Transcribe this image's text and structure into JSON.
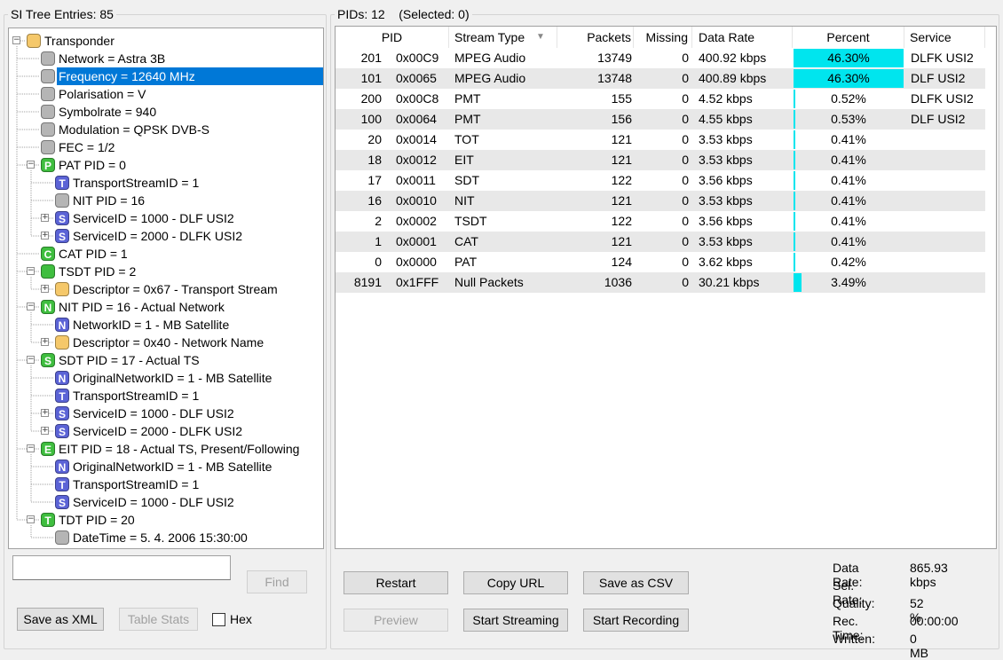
{
  "tree": {
    "title": "SI Tree Entries: 85",
    "nodes": [
      {
        "label": "Transponder",
        "indent": 0,
        "expander": "-",
        "icon": "folder",
        "letter": ""
      },
      {
        "label": "Network = Astra 3B",
        "indent": 1,
        "expander": "",
        "icon": "gray",
        "letter": ""
      },
      {
        "label": "Frequency = 12640 MHz",
        "indent": 1,
        "expander": "",
        "icon": "gray",
        "letter": "",
        "selected": true
      },
      {
        "label": "Polarisation = V",
        "indent": 1,
        "expander": "",
        "icon": "gray",
        "letter": ""
      },
      {
        "label": "Symbolrate = 940",
        "indent": 1,
        "expander": "",
        "icon": "gray",
        "letter": ""
      },
      {
        "label": "Modulation = QPSK DVB-S",
        "indent": 1,
        "expander": "",
        "icon": "gray",
        "letter": ""
      },
      {
        "label": "FEC = 1/2",
        "indent": 1,
        "expander": "",
        "icon": "gray",
        "letter": ""
      },
      {
        "label": "PAT PID = 0",
        "indent": 1,
        "expander": "-",
        "icon": "green",
        "letter": "P"
      },
      {
        "label": "TransportStreamID = 1",
        "indent": 2,
        "expander": "",
        "icon": "blue",
        "letter": "T"
      },
      {
        "label": "NIT PID = 16",
        "indent": 2,
        "expander": "",
        "icon": "gray",
        "letter": ""
      },
      {
        "label": "ServiceID = 1000 - DLF USI2",
        "indent": 2,
        "expander": "+",
        "icon": "blue",
        "letter": "S"
      },
      {
        "label": "ServiceID = 2000 - DLFK USI2",
        "indent": 2,
        "expander": "+",
        "icon": "blue",
        "letter": "S"
      },
      {
        "label": "CAT PID = 1",
        "indent": 1,
        "expander": "",
        "icon": "green",
        "letter": "C"
      },
      {
        "label": "TSDT PID = 2",
        "indent": 1,
        "expander": "-",
        "icon": "green",
        "letter": ""
      },
      {
        "label": "Descriptor = 0x67 - Transport Stream",
        "indent": 2,
        "expander": "+",
        "icon": "folder",
        "letter": ""
      },
      {
        "label": "NIT PID = 16 - Actual Network",
        "indent": 1,
        "expander": "-",
        "icon": "green",
        "letter": "N"
      },
      {
        "label": "NetworkID = 1 - MB Satellite",
        "indent": 2,
        "expander": "",
        "icon": "blue",
        "letter": "N"
      },
      {
        "label": "Descriptor = 0x40 - Network Name",
        "indent": 2,
        "expander": "+",
        "icon": "folder",
        "letter": ""
      },
      {
        "label": "SDT PID = 17 - Actual TS",
        "indent": 1,
        "expander": "-",
        "icon": "green",
        "letter": "S"
      },
      {
        "label": "OriginalNetworkID = 1 - MB Satellite",
        "indent": 2,
        "expander": "",
        "icon": "blue",
        "letter": "N"
      },
      {
        "label": "TransportStreamID = 1",
        "indent": 2,
        "expander": "",
        "icon": "blue",
        "letter": "T"
      },
      {
        "label": "ServiceID = 1000 - DLF USI2",
        "indent": 2,
        "expander": "+",
        "icon": "blue",
        "letter": "S"
      },
      {
        "label": "ServiceID = 2000 - DLFK USI2",
        "indent": 2,
        "expander": "+",
        "icon": "blue",
        "letter": "S"
      },
      {
        "label": "EIT PID = 18 - Actual TS, Present/Following",
        "indent": 1,
        "expander": "-",
        "icon": "green",
        "letter": "E"
      },
      {
        "label": "OriginalNetworkID = 1 - MB Satellite",
        "indent": 2,
        "expander": "",
        "icon": "blue",
        "letter": "N"
      },
      {
        "label": "TransportStreamID = 1",
        "indent": 2,
        "expander": "",
        "icon": "blue",
        "letter": "T"
      },
      {
        "label": "ServiceID = 1000 - DLF USI2",
        "indent": 2,
        "expander": "",
        "icon": "blue",
        "letter": "S"
      },
      {
        "label": "TDT PID = 20",
        "indent": 1,
        "expander": "-",
        "icon": "green",
        "letter": "T"
      },
      {
        "label": "DateTime = 5. 4. 2006 15:30:00",
        "indent": 2,
        "expander": "",
        "icon": "gray",
        "letter": ""
      }
    ]
  },
  "left_controls": {
    "find_value": "",
    "find_label": "Find",
    "save_xml_label": "Save as XML",
    "table_stats_label": "Table Stats",
    "hex_label": "Hex"
  },
  "pids": {
    "title": "PIDs: 12    (Selected: 0)",
    "columns": {
      "pid": "PID",
      "stream_type": "Stream Type",
      "packets": "Packets",
      "missing": "Missing",
      "data_rate": "Data Rate",
      "percent": "Percent",
      "service": "Service"
    },
    "rows": [
      {
        "pid": "201",
        "hex": "0x00C9",
        "type": "MPEG Audio",
        "packets": "13749",
        "missing": "0",
        "rate": "400.92 kbps",
        "percent": "46.30%",
        "pct": 46.3,
        "service": "DLFK USI2"
      },
      {
        "pid": "101",
        "hex": "0x0065",
        "type": "MPEG Audio",
        "packets": "13748",
        "missing": "0",
        "rate": "400.89 kbps",
        "percent": "46.30%",
        "pct": 46.3,
        "service": "DLF USI2"
      },
      {
        "pid": "200",
        "hex": "0x00C8",
        "type": "PMT",
        "packets": "155",
        "missing": "0",
        "rate": "4.52 kbps",
        "percent": "0.52%",
        "pct": 0.52,
        "service": "DLFK USI2"
      },
      {
        "pid": "100",
        "hex": "0x0064",
        "type": "PMT",
        "packets": "156",
        "missing": "0",
        "rate": "4.55 kbps",
        "percent": "0.53%",
        "pct": 0.53,
        "service": "DLF USI2"
      },
      {
        "pid": "20",
        "hex": "0x0014",
        "type": "TOT",
        "packets": "121",
        "missing": "0",
        "rate": "3.53 kbps",
        "percent": "0.41%",
        "pct": 0.41,
        "service": ""
      },
      {
        "pid": "18",
        "hex": "0x0012",
        "type": "EIT",
        "packets": "121",
        "missing": "0",
        "rate": "3.53 kbps",
        "percent": "0.41%",
        "pct": 0.41,
        "service": ""
      },
      {
        "pid": "17",
        "hex": "0x0011",
        "type": "SDT",
        "packets": "122",
        "missing": "0",
        "rate": "3.56 kbps",
        "percent": "0.41%",
        "pct": 0.41,
        "service": ""
      },
      {
        "pid": "16",
        "hex": "0x0010",
        "type": "NIT",
        "packets": "121",
        "missing": "0",
        "rate": "3.53 kbps",
        "percent": "0.41%",
        "pct": 0.41,
        "service": ""
      },
      {
        "pid": "2",
        "hex": "0x0002",
        "type": "TSDT",
        "packets": "122",
        "missing": "0",
        "rate": "3.56 kbps",
        "percent": "0.41%",
        "pct": 0.41,
        "service": ""
      },
      {
        "pid": "1",
        "hex": "0x0001",
        "type": "CAT",
        "packets": "121",
        "missing": "0",
        "rate": "3.53 kbps",
        "percent": "0.41%",
        "pct": 0.41,
        "service": ""
      },
      {
        "pid": "0",
        "hex": "0x0000",
        "type": "PAT",
        "packets": "124",
        "missing": "0",
        "rate": "3.62 kbps",
        "percent": "0.42%",
        "pct": 0.42,
        "service": ""
      },
      {
        "pid": "8191",
        "hex": "0x1FFF",
        "type": "Null Packets",
        "packets": "1036",
        "missing": "0",
        "rate": "30.21 kbps",
        "percent": "3.49%",
        "pct": 3.49,
        "service": ""
      }
    ]
  },
  "buttons": {
    "restart": "Restart",
    "copy_url": "Copy URL",
    "save_csv": "Save as CSV",
    "preview": "Preview",
    "start_streaming": "Start Streaming",
    "start_recording": "Start Recording"
  },
  "stats": {
    "data_rate_label": "Data Rate:",
    "data_rate_value": "865.93 kbps",
    "sel_rate_label": "Sel. Rate:",
    "sel_rate_value": "",
    "quality_label": "Quality:",
    "quality_value": "52 %",
    "rec_time_label": "Rec. Time:",
    "rec_time_value": "00:00:00",
    "written_label": "Written:",
    "written_value": "0 MB"
  },
  "colors": {
    "selection": "#0078d7",
    "percent_bar": "#00e5ee",
    "icon_gray": "#b5b5b5",
    "icon_folder": "#f5c86a",
    "icon_green": "#3fbe3f",
    "icon_blue": "#5b63d6"
  }
}
